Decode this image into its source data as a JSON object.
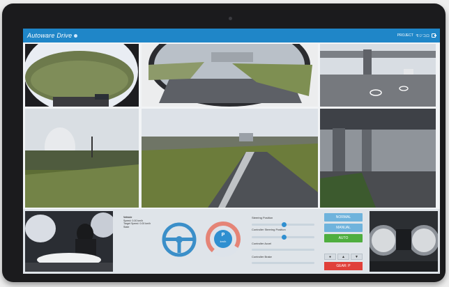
{
  "app": {
    "title": "Autoware Drive"
  },
  "header": {
    "project_label": "PROJECT",
    "project_name": "モジコロ"
  },
  "vehicle": {
    "title": "Vehicle",
    "speed": "Speed: 0.00 km/h",
    "target_speed": "Target Speed: 0.00 km/h",
    "state": "State"
  },
  "speed_gauge": {
    "gear": "P",
    "unit": "km/h"
  },
  "controls": {
    "steering_position": "Steering Position",
    "controller_steering_position": "Controller Steering Position",
    "controller_accel": "Controller Accel",
    "controller_brake": "Controller Brake"
  },
  "modes": {
    "normal": "NORMAL",
    "manual": "MANUAL",
    "auto": "AUTO"
  },
  "gear": {
    "label": "GEAR: P",
    "down": "▼",
    "up": "▲",
    "stop": "●"
  },
  "colors": {
    "accent": "#1f86c8",
    "button": "#6fb3dc",
    "auto": "#4fae3f",
    "gear": "#e0403a"
  }
}
